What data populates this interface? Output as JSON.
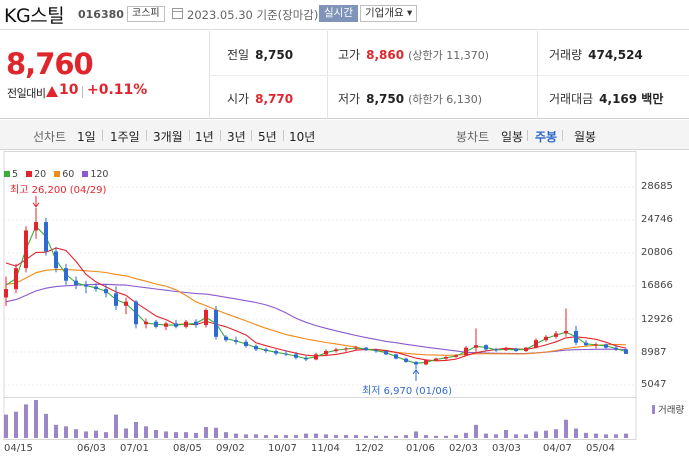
{
  "header": {
    "stock_name": "KG스틸",
    "stock_code": "016380",
    "market_badge": "코스피",
    "date_label": "2023.05.30 기준(장마감)",
    "realtime_button": "실시간",
    "company_info_button": "기업개요 ▾"
  },
  "price": {
    "current": "8,760",
    "change_label": "전일대비",
    "change_value": "10",
    "change_pct": "+0.11%"
  },
  "summary": {
    "prev_close_label": "전일",
    "prev_close": "8,750",
    "high_label": "고가",
    "high": "8,860",
    "upper_limit": "(상한가 11,370)",
    "volume_label": "거래량",
    "volume": "474,524",
    "open_label": "시가",
    "open": "8,770",
    "low_label": "저가",
    "low": "8,750",
    "lower_limit": "(하한가 6,130)",
    "amount_label": "거래대금",
    "amount": "4,169 백만"
  },
  "period_tabs": {
    "line_label": "선차트",
    "items": [
      "1일",
      "1주일",
      "3개월",
      "1년",
      "3년",
      "5년",
      "10년"
    ],
    "candle_label": "봉차트",
    "candle_items": [
      "일봉",
      "주봉",
      "월봉"
    ],
    "active_candle": "주봉"
  },
  "colors": {
    "up": "#e0262d",
    "down": "#2f6ad0",
    "ma5": "#3aad3a",
    "ma20": "#e0262d",
    "ma60": "#f08a1c",
    "ma120": "#8a5bd0",
    "volume": "#9b86c7"
  },
  "chart_data": {
    "type": "candlestick",
    "legend": [
      {
        "name": "5",
        "color": "#3aad3a"
      },
      {
        "name": "20",
        "color": "#e0262d"
      },
      {
        "name": "60",
        "color": "#f08a1c"
      },
      {
        "name": "120",
        "color": "#8a5bd0"
      }
    ],
    "y_ticks": [
      28685,
      24746,
      20806,
      16866,
      12926,
      8987,
      5047
    ],
    "ylim": [
      5047,
      28685
    ],
    "x_ticks": [
      "04/15",
      "06/03",
      "07/01",
      "08/05",
      "09/02",
      "10/07",
      "11/04",
      "12/02",
      "01/06",
      "02/03",
      "03/03",
      "04/07",
      "05/04"
    ],
    "high_annotation": "최고 26,200 (04/29)",
    "low_annotation": "최저 6,970 (01/06)",
    "volume_label": "거래량",
    "candles": [
      [
        15500,
        18000,
        14500,
        16500
      ],
      [
        16500,
        19500,
        16000,
        19000
      ],
      [
        19000,
        24000,
        18500,
        23500
      ],
      [
        23500,
        26200,
        22500,
        24500
      ],
      [
        24500,
        25000,
        20500,
        21000
      ],
      [
        21000,
        21500,
        18500,
        19000
      ],
      [
        19000,
        19500,
        17000,
        17500
      ],
      [
        17500,
        18000,
        16500,
        17000
      ],
      [
        17000,
        17500,
        16000,
        16800
      ],
      [
        16800,
        17200,
        16200,
        16500
      ],
      [
        16500,
        17000,
        15500,
        16000
      ],
      [
        16000,
        16800,
        14000,
        14500
      ],
      [
        14500,
        15500,
        13500,
        15000
      ],
      [
        15000,
        15200,
        11800,
        12300
      ],
      [
        12300,
        13000,
        11800,
        12600
      ],
      [
        12600,
        12800,
        11800,
        12000
      ],
      [
        12000,
        12600,
        11600,
        12400
      ],
      [
        12400,
        12800,
        11800,
        12000
      ],
      [
        12000,
        12800,
        11800,
        12600
      ],
      [
        12600,
        12900,
        11900,
        12200
      ],
      [
        12200,
        14200,
        11900,
        14000
      ],
      [
        14000,
        14500,
        10500,
        10800
      ],
      [
        10800,
        11000,
        10200,
        10400
      ],
      [
        10400,
        10800,
        9900,
        10200
      ],
      [
        10200,
        10500,
        9500,
        9700
      ],
      [
        9700,
        9900,
        9100,
        9300
      ],
      [
        9300,
        9500,
        8900,
        9100
      ],
      [
        9100,
        9300,
        8600,
        8800
      ],
      [
        8800,
        9200,
        8500,
        8700
      ],
      [
        8700,
        9000,
        8100,
        8300
      ],
      [
        8300,
        8500,
        7900,
        8100
      ],
      [
        8100,
        8900,
        8000,
        8700
      ],
      [
        8700,
        9300,
        8500,
        9100
      ],
      [
        9100,
        9500,
        8900,
        9300
      ],
      [
        9300,
        9600,
        9000,
        9400
      ],
      [
        9400,
        9700,
        9200,
        9500
      ],
      [
        9500,
        9600,
        9100,
        9200
      ],
      [
        9200,
        9400,
        8900,
        9100
      ],
      [
        9100,
        9200,
        8600,
        8700
      ],
      [
        8700,
        8800,
        8100,
        8200
      ],
      [
        8200,
        8300,
        7700,
        7800
      ],
      [
        7800,
        7900,
        6970,
        7500
      ],
      [
        7500,
        8100,
        7400,
        8000
      ],
      [
        8000,
        8300,
        7900,
        8200
      ],
      [
        8200,
        8500,
        8000,
        8400
      ],
      [
        8400,
        8700,
        8300,
        8600
      ],
      [
        8600,
        9700,
        8500,
        9500
      ],
      [
        9500,
        11800,
        9000,
        9800
      ],
      [
        9800,
        9900,
        9100,
        9300
      ],
      [
        9300,
        9500,
        9000,
        9200
      ],
      [
        9200,
        9600,
        9100,
        9400
      ],
      [
        9400,
        9500,
        9000,
        9100
      ],
      [
        9100,
        9600,
        9000,
        9500
      ],
      [
        9500,
        10600,
        9400,
        10400
      ],
      [
        10400,
        11000,
        10200,
        10800
      ],
      [
        10800,
        11500,
        10600,
        11200
      ],
      [
        11200,
        14200,
        10800,
        11500
      ],
      [
        11500,
        12100,
        9800,
        10100
      ],
      [
        10100,
        10400,
        9700,
        9800
      ],
      [
        9800,
        10100,
        9400,
        9900
      ],
      [
        9900,
        10000,
        9400,
        9500
      ],
      [
        9500,
        9800,
        9100,
        9300
      ],
      [
        9300,
        9400,
        8750,
        8760
      ]
    ],
    "volume": [
      3.2,
      3.6,
      4.6,
      5.2,
      3.3,
      1.8,
      1.6,
      1.2,
      0.9,
      1.0,
      0.8,
      3.2,
      1.3,
      2.2,
      1.6,
      1.1,
      0.9,
      0.8,
      0.8,
      0.7,
      1.5,
      1.4,
      0.8,
      0.6,
      0.5,
      0.5,
      0.4,
      0.4,
      0.4,
      0.4,
      0.6,
      0.6,
      0.5,
      0.4,
      0.4,
      0.4,
      0.3,
      0.3,
      0.3,
      0.3,
      0.4,
      0.9,
      0.4,
      0.3,
      0.3,
      0.4,
      0.7,
      1.8,
      0.6,
      0.5,
      1.1,
      0.5,
      0.5,
      0.9,
      1.0,
      1.2,
      2.5,
      1.3,
      0.7,
      0.6,
      0.5,
      0.5,
      0.6
    ]
  }
}
